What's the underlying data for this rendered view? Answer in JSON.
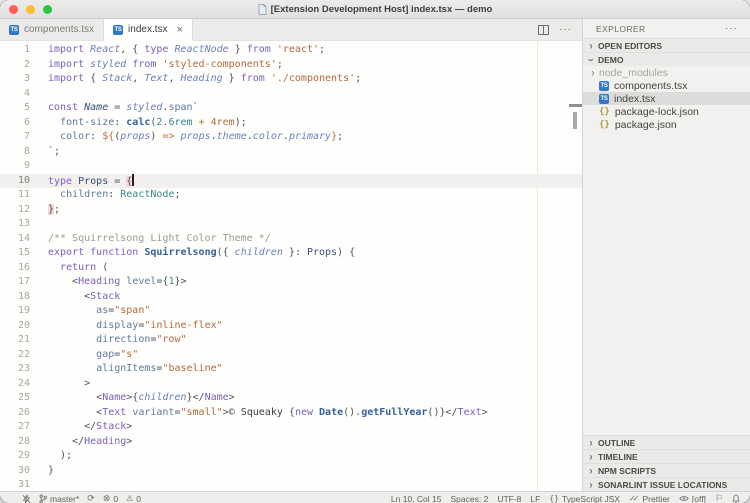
{
  "window": {
    "title": "[Extension Development Host] index.tsx — demo"
  },
  "traffic_lights": {
    "close": "#ff5f57",
    "minimize": "#febc2e",
    "zoom": "#28c840"
  },
  "colors": {
    "kw": "#7c5ec1",
    "vi": "#6c80bd",
    "ty": "#38878c",
    "st": "#b4683c",
    "nu": "#38878c",
    "op": "#c06b3a",
    "pr": "#5e7a9e",
    "fn": "#33619e",
    "tg": "#7c5ec1",
    "pn": "#4e5258",
    "tx": "#3e3d3b",
    "cm": "#9c9b92",
    "nv": "#394e75",
    "accent": "#3178c6"
  },
  "tabs": [
    {
      "label": "components.tsx",
      "icon": "ts",
      "active": false
    },
    {
      "label": "index.tsx",
      "icon": "ts",
      "active": true,
      "close": "×"
    }
  ],
  "editor": {
    "current_line": 10,
    "cursor": {
      "line": 10,
      "col": 15
    },
    "lines": [
      {
        "n": 1,
        "t": [
          [
            "kw",
            "import"
          ],
          [
            "pn",
            " "
          ],
          [
            "vi",
            "React"
          ],
          [
            "pn",
            ", { "
          ],
          [
            "kw",
            "type"
          ],
          [
            "pn",
            " "
          ],
          [
            "vi",
            "ReactNode"
          ],
          [
            "pn",
            " } "
          ],
          [
            "kw",
            "from"
          ],
          [
            "pn",
            " "
          ],
          [
            "st",
            "'react'"
          ],
          [
            "pn",
            ";"
          ]
        ]
      },
      {
        "n": 2,
        "t": [
          [
            "kw",
            "import"
          ],
          [
            "pn",
            " "
          ],
          [
            "vi",
            "styled"
          ],
          [
            "pn",
            " "
          ],
          [
            "kw",
            "from"
          ],
          [
            "pn",
            " "
          ],
          [
            "st",
            "'styled-components'"
          ],
          [
            "pn",
            ";"
          ]
        ]
      },
      {
        "n": 3,
        "t": [
          [
            "kw",
            "import"
          ],
          [
            "pn",
            " { "
          ],
          [
            "vi",
            "Stack"
          ],
          [
            "pn",
            ", "
          ],
          [
            "vi",
            "Text"
          ],
          [
            "pn",
            ", "
          ],
          [
            "vi",
            "Heading"
          ],
          [
            "pn",
            " } "
          ],
          [
            "kw",
            "from"
          ],
          [
            "pn",
            " "
          ],
          [
            "st",
            "'./components'"
          ],
          [
            "pn",
            ";"
          ]
        ]
      },
      {
        "n": 4,
        "t": []
      },
      {
        "n": 5,
        "t": [
          [
            "kw",
            "const"
          ],
          [
            "pn",
            " "
          ],
          [
            "nvi",
            "Name"
          ],
          [
            "pn",
            " = "
          ],
          [
            "vi",
            "styled"
          ],
          [
            "pn",
            "."
          ],
          [
            "pr",
            "span"
          ],
          [
            "pn",
            "`"
          ]
        ]
      },
      {
        "n": 6,
        "t": [
          [
            "pn",
            "  "
          ],
          [
            "pr",
            "font-size"
          ],
          [
            "pn",
            ": "
          ],
          [
            "fn",
            "calc"
          ],
          [
            "pn",
            "("
          ],
          [
            "nu",
            "2.6rem"
          ],
          [
            "pn",
            " "
          ],
          [
            "op",
            "+"
          ],
          [
            "pn",
            " "
          ],
          [
            "st",
            "4rem"
          ],
          [
            "pn",
            ");"
          ]
        ]
      },
      {
        "n": 7,
        "t": [
          [
            "pn",
            "  "
          ],
          [
            "pr",
            "color"
          ],
          [
            "pn",
            ": "
          ],
          [
            "op",
            "${"
          ],
          [
            "pn",
            "("
          ],
          [
            "vi",
            "props"
          ],
          [
            "pn",
            ") "
          ],
          [
            "op",
            "=>"
          ],
          [
            "pn",
            " "
          ],
          [
            "vi",
            "props"
          ],
          [
            "pn",
            "."
          ],
          [
            "vi",
            "theme"
          ],
          [
            "pn",
            "."
          ],
          [
            "vi",
            "color"
          ],
          [
            "pn",
            "."
          ],
          [
            "vi",
            "primary"
          ],
          [
            "op",
            "}"
          ],
          [
            "pn",
            ";"
          ]
        ]
      },
      {
        "n": 8,
        "t": [
          [
            "pn",
            "`;"
          ]
        ]
      },
      {
        "n": 9,
        "t": []
      },
      {
        "n": 10,
        "t": [
          [
            "kw",
            "type"
          ],
          [
            "pn",
            " "
          ],
          [
            "nv",
            "Props"
          ],
          [
            "pn",
            " = "
          ],
          [
            "bk",
            "{"
          ]
        ],
        "cursor": true
      },
      {
        "n": 11,
        "t": [
          [
            "pn",
            "  "
          ],
          [
            "pr",
            "children"
          ],
          [
            "pn",
            ": "
          ],
          [
            "ty",
            "ReactNode"
          ],
          [
            "pn",
            ";"
          ]
        ]
      },
      {
        "n": 12,
        "t": [
          [
            "bk",
            "}"
          ],
          [
            "pn",
            ";"
          ]
        ]
      },
      {
        "n": 13,
        "t": []
      },
      {
        "n": 14,
        "t": [
          [
            "cm",
            "/** Squirrelsong Light Color Theme */"
          ]
        ]
      },
      {
        "n": 15,
        "t": [
          [
            "kw",
            "export"
          ],
          [
            "pn",
            " "
          ],
          [
            "kw",
            "function"
          ],
          [
            "pn",
            " "
          ],
          [
            "fn",
            "Squirrelsong"
          ],
          [
            "pn",
            "({ "
          ],
          [
            "vi",
            "children"
          ],
          [
            "pn",
            " }: "
          ],
          [
            "nv",
            "Props"
          ],
          [
            "pn",
            ") {"
          ]
        ]
      },
      {
        "n": 16,
        "t": [
          [
            "pn",
            "  "
          ],
          [
            "kw",
            "return"
          ],
          [
            "pn",
            " ("
          ]
        ]
      },
      {
        "n": 17,
        "t": [
          [
            "pn",
            "    <"
          ],
          [
            "tg",
            "Heading"
          ],
          [
            "pn",
            " "
          ],
          [
            "pr",
            "level"
          ],
          [
            "pn",
            "={"
          ],
          [
            "nu",
            "1"
          ],
          [
            "pn",
            "}>"
          ]
        ]
      },
      {
        "n": 18,
        "t": [
          [
            "pn",
            "      <"
          ],
          [
            "tg",
            "Stack"
          ]
        ]
      },
      {
        "n": 19,
        "t": [
          [
            "pn",
            "        "
          ],
          [
            "pr",
            "as"
          ],
          [
            "pn",
            "="
          ],
          [
            "st",
            "\"span\""
          ]
        ]
      },
      {
        "n": 20,
        "t": [
          [
            "pn",
            "        "
          ],
          [
            "pr",
            "display"
          ],
          [
            "pn",
            "="
          ],
          [
            "st",
            "\"inline-flex\""
          ]
        ]
      },
      {
        "n": 21,
        "t": [
          [
            "pn",
            "        "
          ],
          [
            "pr",
            "direction"
          ],
          [
            "pn",
            "="
          ],
          [
            "st",
            "\"row\""
          ]
        ]
      },
      {
        "n": 22,
        "t": [
          [
            "pn",
            "        "
          ],
          [
            "pr",
            "gap"
          ],
          [
            "pn",
            "="
          ],
          [
            "st",
            "\"s\""
          ]
        ]
      },
      {
        "n": 23,
        "t": [
          [
            "pn",
            "        "
          ],
          [
            "pr",
            "alignItems"
          ],
          [
            "pn",
            "="
          ],
          [
            "st",
            "\"baseline\""
          ]
        ]
      },
      {
        "n": 24,
        "t": [
          [
            "pn",
            "      >"
          ]
        ]
      },
      {
        "n": 25,
        "t": [
          [
            "pn",
            "        <"
          ],
          [
            "tg",
            "Name"
          ],
          [
            "pn",
            ">{"
          ],
          [
            "vi",
            "children"
          ],
          [
            "pn",
            "}</"
          ],
          [
            "tg",
            "Name"
          ],
          [
            "pn",
            ">"
          ]
        ]
      },
      {
        "n": 26,
        "t": [
          [
            "pn",
            "        <"
          ],
          [
            "tg",
            "Text"
          ],
          [
            "pn",
            " "
          ],
          [
            "pr",
            "variant"
          ],
          [
            "pn",
            "="
          ],
          [
            "st",
            "\"small\""
          ],
          [
            "pn",
            ">"
          ],
          [
            "tx",
            "© Squeaky "
          ],
          [
            "pn",
            "{"
          ],
          [
            "kw",
            "new"
          ],
          [
            "pn",
            " "
          ],
          [
            "fn",
            "Date"
          ],
          [
            "pn",
            "()."
          ],
          [
            "fn",
            "getFullYear"
          ],
          [
            "pn",
            "()}</"
          ],
          [
            "tg",
            "Text"
          ],
          [
            "pn",
            ">"
          ]
        ]
      },
      {
        "n": 27,
        "t": [
          [
            "pn",
            "      </"
          ],
          [
            "tg",
            "Stack"
          ],
          [
            "pn",
            ">"
          ]
        ]
      },
      {
        "n": 28,
        "t": [
          [
            "pn",
            "    </"
          ],
          [
            "tg",
            "Heading"
          ],
          [
            "pn",
            ">"
          ]
        ]
      },
      {
        "n": 29,
        "t": [
          [
            "pn",
            "  );"
          ]
        ]
      },
      {
        "n": 30,
        "t": [
          [
            "pn",
            "}"
          ]
        ]
      },
      {
        "n": 31,
        "t": []
      }
    ]
  },
  "explorer": {
    "title": "EXPLORER",
    "more_label": "···",
    "sections_top": [
      {
        "label": "OPEN EDITORS",
        "expanded": false
      },
      {
        "label": "DEMO",
        "expanded": true
      }
    ],
    "files": [
      {
        "name": "node_modules",
        "type": "folder",
        "dim": true,
        "selected": false
      },
      {
        "name": "components.tsx",
        "type": "ts",
        "dim": false,
        "selected": false
      },
      {
        "name": "index.tsx",
        "type": "ts",
        "dim": false,
        "selected": true
      },
      {
        "name": "package-lock.json",
        "type": "json",
        "dim": false,
        "selected": false
      },
      {
        "name": "package.json",
        "type": "json",
        "dim": false,
        "selected": false
      }
    ],
    "sections_bottom": [
      "OUTLINE",
      "TIMELINE",
      "NPM SCRIPTS",
      "SONARLINT ISSUE LOCATIONS"
    ],
    "ts_badge_text": "TS",
    "json_badge_text": "{}"
  },
  "status_bar": {
    "left": [
      {
        "icon": "zap-off",
        "label": ""
      },
      {
        "icon": "git-branch",
        "label": "master*"
      },
      {
        "icon": "sync",
        "label": ""
      },
      {
        "icon": "error-circle",
        "label": "0"
      },
      {
        "icon": "warning",
        "label": "0"
      }
    ],
    "right": [
      {
        "icon": "",
        "label": "Ln 10, Col 15"
      },
      {
        "icon": "",
        "label": "Spaces: 2"
      },
      {
        "icon": "",
        "label": "UTF-8"
      },
      {
        "icon": "",
        "label": "LF"
      },
      {
        "icon": "braces",
        "label": "TypeScript JSX"
      },
      {
        "icon": "double-check",
        "label": "Prettier"
      },
      {
        "icon": "eye",
        "label": "[off]"
      },
      {
        "icon": "flag",
        "label": ""
      },
      {
        "icon": "bell",
        "label": ""
      }
    ]
  }
}
